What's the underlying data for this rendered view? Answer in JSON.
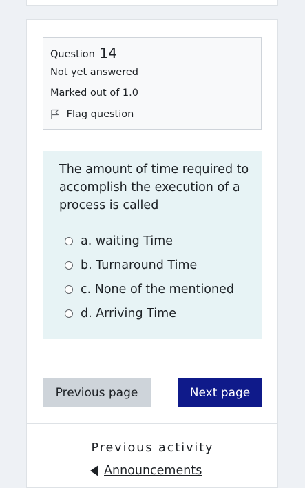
{
  "question": {
    "label": "Question",
    "number": "14",
    "status": "Not yet answered",
    "marks": "Marked out of 1.0",
    "flag_label": "Flag question",
    "text": "The amount of time required to accomplish the execution of a process is called",
    "options": [
      {
        "letter": "a.",
        "text": "a. waiting Time"
      },
      {
        "letter": "b.",
        "text": "b. Turnaround Time"
      },
      {
        "letter": "c.",
        "text": "c. None of the mentioned"
      },
      {
        "letter": "d.",
        "text": "d. Arriving Time"
      }
    ]
  },
  "navigation": {
    "previous_page": "Previous page",
    "next_page": "Next page"
  },
  "activity": {
    "previous_activity_label": "Previous activity",
    "previous_activity_link": "Announcements"
  },
  "colors": {
    "background": "#eef1f5",
    "question_box": "#e7f3f5",
    "next_button": "#0f1a8a",
    "previous_button": "#ced4da"
  }
}
